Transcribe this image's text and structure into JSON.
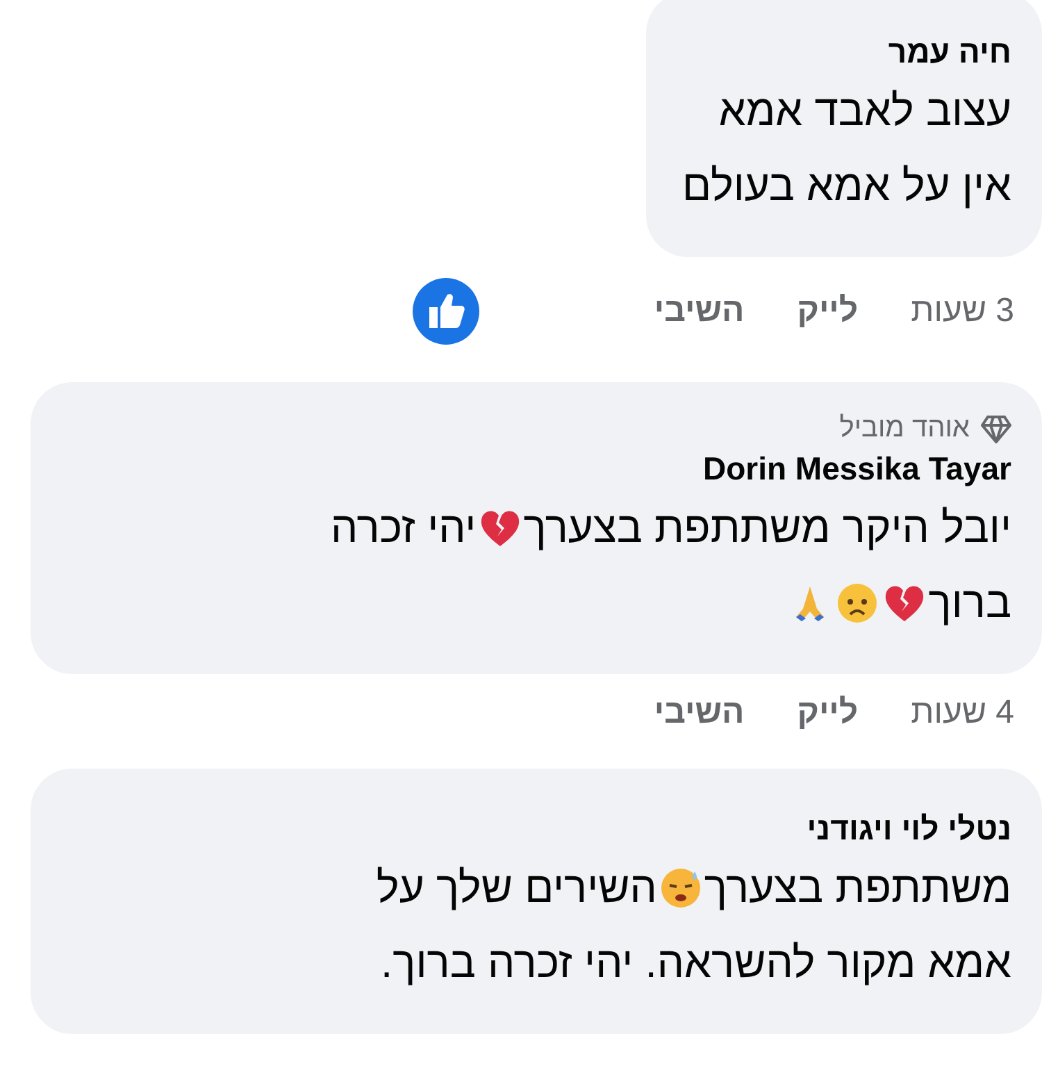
{
  "comments": [
    {
      "author": "חיה עמר",
      "lines": [
        [
          {
            "kind": "text",
            "text": "עצוב לאבד אמא"
          }
        ],
        [
          {
            "kind": "text",
            "text": "אין על אמא בעולם"
          }
        ]
      ],
      "time": "3 שעות",
      "like": "לייק",
      "reply": "השיבי",
      "liked": true
    },
    {
      "badge": "אוהד מוביל",
      "author": "Dorin Messika Tayar",
      "lines": [
        [
          {
            "kind": "text",
            "text": "יובל היקר משתתפת בצערך"
          },
          {
            "kind": "broken_heart"
          },
          {
            "kind": "text",
            "text": "יהי זכרה"
          }
        ],
        [
          {
            "kind": "text",
            "text": "ברוך"
          },
          {
            "kind": "broken_heart"
          },
          {
            "kind": "sad_face"
          },
          {
            "kind": "praying_hands"
          }
        ]
      ],
      "time": "4 שעות",
      "like": "לייק",
      "reply": "השיבי"
    },
    {
      "author": "נטלי לוי ויגודני",
      "lines": [
        [
          {
            "kind": "text",
            "text": "משתתפת בצערך"
          },
          {
            "kind": "sweat_face"
          },
          {
            "kind": "text",
            "text": "השירים שלך על"
          }
        ],
        [
          {
            "kind": "text",
            "text": "אמא מקור להשראה. יהי זכרה ברוך."
          }
        ]
      ]
    }
  ]
}
